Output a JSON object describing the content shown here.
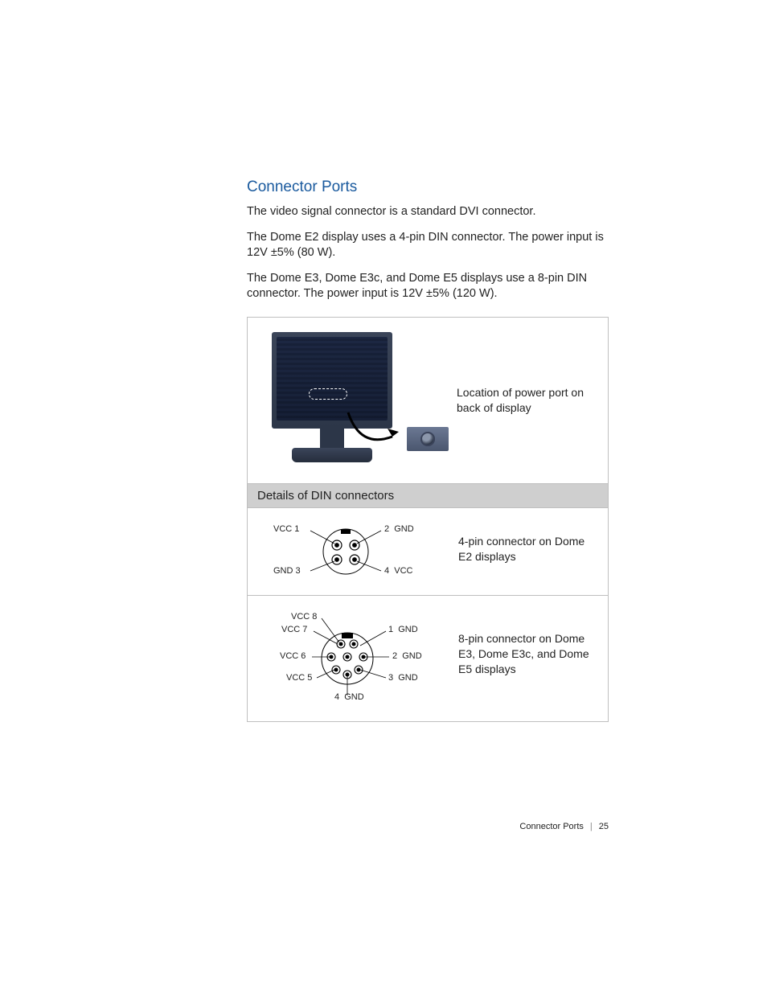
{
  "heading": "Connector Ports",
  "paragraphs": [
    "The video signal connector is a standard DVI connector.",
    "The Dome E2 display uses a 4-pin DIN connector. The power input is 12V ±5% (80 W).",
    "The Dome E3, Dome E3c, and Dome E5 displays use a 8-pin DIN connector. The power input is 12V ±5% (120 W)."
  ],
  "figure": {
    "top_caption": "Location of power port on back of display",
    "band": "Details of DIN connectors",
    "four_pin": {
      "caption": "4-pin connector on Dome E2 displays",
      "pins": [
        {
          "n": 1,
          "label": "VCC"
        },
        {
          "n": 2,
          "label": "GND"
        },
        {
          "n": 3,
          "label": "GND"
        },
        {
          "n": 4,
          "label": "VCC"
        }
      ]
    },
    "eight_pin": {
      "caption": "8-pin connector on Dome E3, Dome E3c, and Dome E5 displays",
      "pins": [
        {
          "n": 1,
          "label": "GND"
        },
        {
          "n": 2,
          "label": "GND"
        },
        {
          "n": 3,
          "label": "GND"
        },
        {
          "n": 4,
          "label": "GND"
        },
        {
          "n": 5,
          "label": "VCC"
        },
        {
          "n": 6,
          "label": "VCC"
        },
        {
          "n": 7,
          "label": "VCC"
        },
        {
          "n": 8,
          "label": "VCC"
        }
      ]
    }
  },
  "footer": {
    "section": "Connector Ports",
    "page": "25"
  }
}
